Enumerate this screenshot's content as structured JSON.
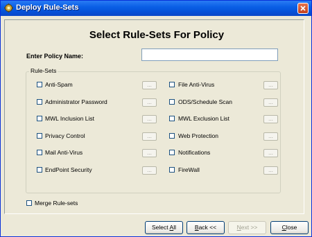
{
  "window": {
    "title": "Deploy Rule-Sets",
    "title_icon": "gear-icon",
    "close_icon": "close-icon"
  },
  "heading": "Select Rule-Sets For Policy",
  "policy_name": {
    "label": "Enter Policy Name:",
    "value": ""
  },
  "rulesets": {
    "group_label": "Rule-Sets",
    "browse_label": "...",
    "left": [
      {
        "label": "Anti-Spam",
        "checked": false
      },
      {
        "label": "Administrator Password",
        "checked": false
      },
      {
        "label": "MWL Inclusion List",
        "checked": false
      },
      {
        "label": "Privacy Control",
        "checked": false
      },
      {
        "label": "Mail Anti-Virus",
        "checked": false
      },
      {
        "label": "EndPoint Security",
        "checked": false
      }
    ],
    "right": [
      {
        "label": "File Anti-Virus",
        "checked": false
      },
      {
        "label": "ODS/Schedule Scan",
        "checked": false
      },
      {
        "label": "MWL Exclusion List",
        "checked": false
      },
      {
        "label": "Web Protection",
        "checked": false
      },
      {
        "label": "Notifications",
        "checked": false
      },
      {
        "label": "FireWall",
        "checked": false
      }
    ]
  },
  "merge": {
    "label": "Merge Rule-sets",
    "checked": false
  },
  "buttons": {
    "select_all": {
      "pre": "Select ",
      "key": "A",
      "post": "ll"
    },
    "back": {
      "pre": "",
      "key": "B",
      "post": "ack <<"
    },
    "next": {
      "pre": "",
      "key": "N",
      "post": "ext >>",
      "enabled": false
    },
    "close": {
      "pre": "",
      "key": "C",
      "post": "lose"
    }
  },
  "colors": {
    "titlebar": "#0a5fe6",
    "face": "#ece9d8",
    "close_button": "#d9512b"
  }
}
